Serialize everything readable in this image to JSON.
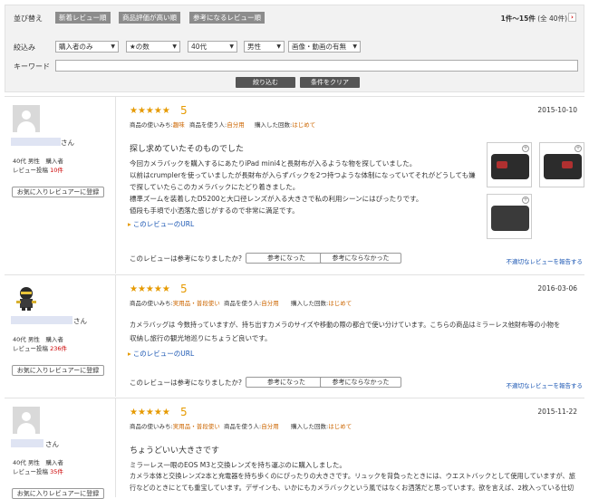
{
  "filter": {
    "sort_label": "並び替え",
    "sort_options": [
      "新着レビュー順",
      "商品評価が高い順",
      "参考になるレビュー順"
    ],
    "count_text": "1件〜15件",
    "count_total": "(全 40件)",
    "next_icon": "chevron-right-icon",
    "narrow_label": "絞込み",
    "selects": [
      "購入者のみ",
      "★の数",
      "40代",
      "男性",
      "画像・動画の有無"
    ],
    "keyword_label": "キーワード",
    "keyword_value": "",
    "apply_button": "絞り込む",
    "clear_button": "条件をクリア"
  },
  "reviews": [
    {
      "user_suffix": "さん",
      "user_info": "40代 男性　購入者",
      "post_label": "レビュー投稿",
      "post_count": "10件",
      "fav_button": "お気に入りレビュアーに登録",
      "stars": "★★★★★",
      "score": "5",
      "meta": [
        {
          "k": "商品の使いみち:",
          "v": "趣味"
        },
        {
          "k": "商品を使う人:",
          "v": "自分用"
        },
        {
          "k": "購入した回数:",
          "v": "はじめて"
        }
      ],
      "date": "2015-10-10",
      "title": "探し求めていたそのものでした",
      "body": [
        "今回カメラバックを購入するにあたりiPad mini4と長財布が入るような物を探していました。",
        "以前はcrumplerを使っていましたが長財布が入らずバックを2つ持つような体制になっていてそれがどうしても嫌",
        "で探していたらこのカメラバックにたどり着きました。",
        "標準ズームを装着したD5200と大口径レンズが入る大きさで私の利用シーンにはぴったりです。",
        "値段も手頃で小洒落た感じがするので非常に満足です。"
      ],
      "url_label": "このレビューのURL",
      "helpful_q": "このレビューは参考になりましたか?",
      "helpful_yes": "参考になった",
      "helpful_no": "参考にならなかった",
      "report": "不適切なレビューを報告する"
    },
    {
      "user_suffix": "さん",
      "user_info": "40代 男性　購入者",
      "post_label": "レビュー投稿",
      "post_count": "236件",
      "fav_button": "お気に入りレビュアーに登録",
      "stars": "★★★★★",
      "score": "5",
      "meta": [
        {
          "k": "商品の使いみち:",
          "v": "実用品・普段使い"
        },
        {
          "k": "商品を使う人:",
          "v": "自分用"
        },
        {
          "k": "購入した回数:",
          "v": "はじめて"
        }
      ],
      "date": "2016-03-06",
      "title": "",
      "body": [
        "カメラバッグは 今数持っていますが、持ち出すカメラのサイズや移動の際の都合で使い分けています。こちらの商品はミラーレス他財布等の小物を",
        "収納し旅行の観光地巡りにちょうど良いです。"
      ],
      "url_label": "このレビューのURL",
      "helpful_q": "このレビューは参考になりましたか?",
      "helpful_yes": "参考になった",
      "helpful_no": "参考にならなかった",
      "report": "不適切なレビューを報告する"
    },
    {
      "user_suffix": "さん",
      "user_info": "40代 男性　購入者",
      "post_label": "レビュー投稿",
      "post_count": "35件",
      "fav_button": "お気に入りレビュアーに登録",
      "stars": "★★★★★",
      "score": "5",
      "meta": [
        {
          "k": "商品の使いみち:",
          "v": "実用品・普段使い"
        },
        {
          "k": "商品を使う人:",
          "v": "自分用"
        },
        {
          "k": "購入した回数:",
          "v": "はじめて"
        }
      ],
      "date": "2015-11-22",
      "title": "ちょうどいい大きさです",
      "body": [
        "ミラーレス一眼のEOS M3と交換レンズを持ち運ぶのに購入しました。",
        "カメラ本体と交換レンズ2本と充電器を持ち歩くのにぴったりの大きさです。リュックを背負ったときには、ウエストバックとして使用していますが、旅",
        "行などのときにとても重宝しています。デザインも、いかにもカメラバックという風ではなくお洒落だと思っています。欲を言えば、2枚入っている仕切"
      ]
    }
  ]
}
